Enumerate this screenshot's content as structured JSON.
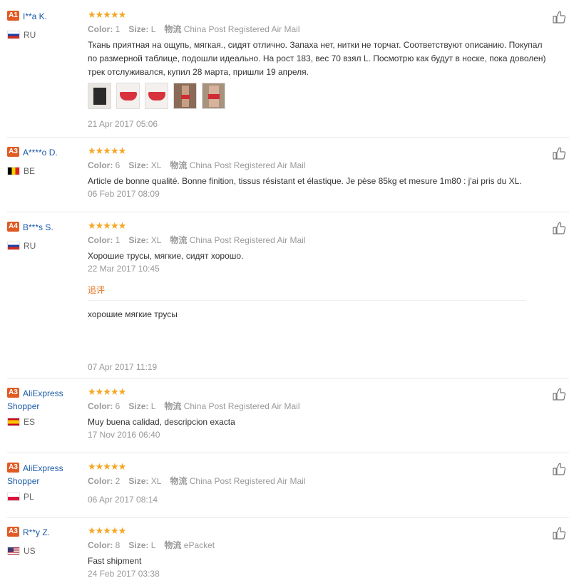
{
  "reviews": [
    {
      "level": "A1",
      "name": "I**a K.",
      "country": "RU",
      "flag": "ru",
      "stars": "★★★★★",
      "color_label": "Color:",
      "color": "1",
      "size_label": "Size:",
      "size": "L",
      "logistics_label": "物流",
      "logistics": "China Post Registered Air Mail",
      "text": "Ткань приятная на ощупь, мягкая., сидят отлично. Запаха нет, нитки не торчат. Соответствуют описанию. Покупал\nпо размерной таблице, подошли идеально. На рост 183, вес 70 взял L. Посмотрю как будут в носке, пока доволен)\nтрек отслуживался, купил 28 марта, пришли 19 апреля.",
      "date": "21 Apr 2017 05:06"
    },
    {
      "level": "A3",
      "name": "A****o D.",
      "country": "BE",
      "flag": "be",
      "stars": "★★★★★",
      "color_label": "Color:",
      "color": "6",
      "size_label": "Size:",
      "size": "XL",
      "logistics_label": "物流",
      "logistics": "China Post Registered Air Mail",
      "text": "Article de bonne qualité. Bonne finition, tissus résistant et élastique. Je pèse 85kg et mesure 1m80 : j'ai pris du XL.",
      "date": "06 Feb 2017 08:09"
    },
    {
      "level": "A4",
      "name": "B***s S.",
      "country": "RU",
      "flag": "ru",
      "stars": "★★★★★",
      "color_label": "Color:",
      "color": "1",
      "size_label": "Size:",
      "size": "XL",
      "logistics_label": "物流",
      "logistics": "China Post Registered Air Mail",
      "text": "Хорошие трусы, мягкие, сидят хорошо.",
      "date": "22 Mar 2017 10:45",
      "append_label": "追评",
      "append_text": "хорошие мягкие трусы",
      "append_date": "07 Apr 2017 11:19"
    },
    {
      "level": "A3",
      "name": "AliExpress Shopper",
      "country": "ES",
      "flag": "es",
      "stars": "★★★★★",
      "color_label": "Color:",
      "color": "6",
      "size_label": "Size:",
      "size": "L",
      "logistics_label": "物流",
      "logistics": "China Post Registered Air Mail",
      "text": "Muy buena calidad, descripcion exacta",
      "date": "17 Nov 2016 06:40"
    },
    {
      "level": "A3",
      "name": "AliExpress Shopper",
      "country": "PL",
      "flag": "pl",
      "stars": "★★★★★",
      "color_label": "Color:",
      "color": "2",
      "size_label": "Size:",
      "size": "XL",
      "logistics_label": "物流",
      "logistics": "China Post Registered Air Mail",
      "text": "",
      "date": "06 Apr 2017 08:14"
    },
    {
      "level": "A3",
      "name": "R**y Z.",
      "country": "US",
      "flag": "us",
      "stars": "★★★★★",
      "color_label": "Color:",
      "color": "8",
      "size_label": "Size:",
      "size": "L",
      "logistics_label": "物流",
      "logistics": "ePacket",
      "text": "Fast shipment",
      "date": "24 Feb 2017 03:38"
    }
  ],
  "colors": {
    "level_badge": "#e05b24",
    "username": "#1a5aa8",
    "stars": "#f5a623",
    "append": "#e5701b"
  },
  "icons": {
    "like": "thumbs-up-icon"
  }
}
